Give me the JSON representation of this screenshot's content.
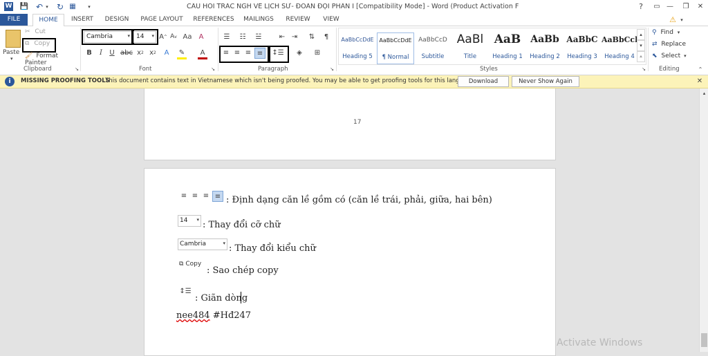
{
  "title": "CÂU HỎI TRẮC NGH VỀ LỊCH SỬ- ĐOÀN ĐỘI  PHẦN I [Compatibility Mode] - Word (Product Activation Failed)",
  "window_controls": {
    "help": "?",
    "minimize": "—",
    "restore": "❐",
    "close": "✕"
  },
  "tabs": [
    "FILE",
    "HOME",
    "INSERT",
    "DESIGN",
    "PAGE LAYOUT",
    "REFERENCES",
    "MAILINGS",
    "REVIEW",
    "VIEW"
  ],
  "clipboard": {
    "paste": "Paste",
    "cut": "Cut",
    "copy": "Copy",
    "format_painter": "Format Painter",
    "label": "Clipboard"
  },
  "font": {
    "name": "Cambria",
    "size": "14",
    "label": "Font"
  },
  "paragraph": {
    "label": "Paragraph"
  },
  "styles": {
    "label": "Styles",
    "items": [
      {
        "sample": "AaBbCcDdE",
        "name": "Heading 5"
      },
      {
        "sample": "AaBbCcDdE",
        "name": "¶ Normal"
      },
      {
        "sample": "AaBbCcD",
        "name": "Subtitle"
      },
      {
        "sample": "AaBl",
        "name": "Title"
      },
      {
        "sample": "AaB",
        "name": "Heading 1"
      },
      {
        "sample": "AaBb",
        "name": "Heading 2"
      },
      {
        "sample": "AaBbC",
        "name": "Heading 3"
      },
      {
        "sample": "AaBbCcl",
        "name": "Heading 4"
      }
    ]
  },
  "editing": {
    "find": "Find",
    "replace": "Replace",
    "select": "Select",
    "label": "Editing"
  },
  "message_bar": {
    "title": "MISSING PROOFING TOOLS",
    "text": "This document contains text in Vietnamese which isn't being proofed. You may be able to get proofing tools for this language.",
    "download": "Download",
    "never": "Never Show Again"
  },
  "page_number": "17",
  "document": {
    "line1": ": Định dạng căn lề gồm có (căn lề trái, phải, giữa, hai bên)",
    "size_sample": "14",
    "line2": ": Thay đổi cỡ chữ",
    "font_sample": "Cambria",
    "line3": ": Thay đổi kiểu chữ",
    "copy_sample": "Copy",
    "line4": ": Sao chép copy",
    "line5": ": Giãn dòng",
    "footer_a": "nee484",
    "footer_b": " #Hđ247"
  },
  "watermark": "Activate Windows",
  "colors": {
    "brand": "#2b579a",
    "msgbar": "#fcf3b9"
  }
}
